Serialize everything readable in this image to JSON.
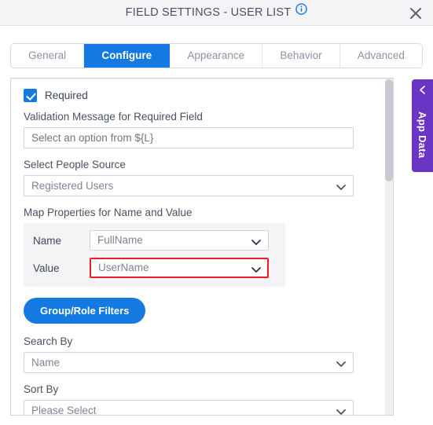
{
  "header": {
    "title": "FIELD SETTINGS - USER LIST",
    "info_icon": "info-circle-icon",
    "close_icon": "close-icon"
  },
  "tabs": [
    {
      "label": "General",
      "active": false
    },
    {
      "label": "Configure",
      "active": true
    },
    {
      "label": "Appearance",
      "active": false
    },
    {
      "label": "Behavior",
      "active": false
    },
    {
      "label": "Advanced",
      "active": false
    }
  ],
  "form": {
    "required_checkbox": {
      "label": "Required",
      "checked": true
    },
    "validation_message": {
      "label": "Validation Message for Required Field",
      "value": "",
      "placeholder": "Select an option from ${L}"
    },
    "people_source": {
      "label": "Select People Source",
      "value": "Registered Users"
    },
    "map_properties": {
      "label": "Map Properties for Name and Value",
      "name_label": "Name",
      "name_value": "FullName",
      "value_label": "Value",
      "value_value": "UserName",
      "highlight_color": "#ee1c25"
    },
    "group_role_filters_button": "Group/Role Filters",
    "search_by": {
      "label": "Search By",
      "value": "Name"
    },
    "sort_by": {
      "label": "Sort By",
      "value": "Please Select"
    }
  },
  "side_panel": {
    "label": "App Data",
    "collapse_icon": "chevron-left-icon",
    "color": "#6a34c4"
  },
  "colors": {
    "accent": "#1479e0",
    "header_bg": "#f4f4f6",
    "text": "#4a5163"
  }
}
